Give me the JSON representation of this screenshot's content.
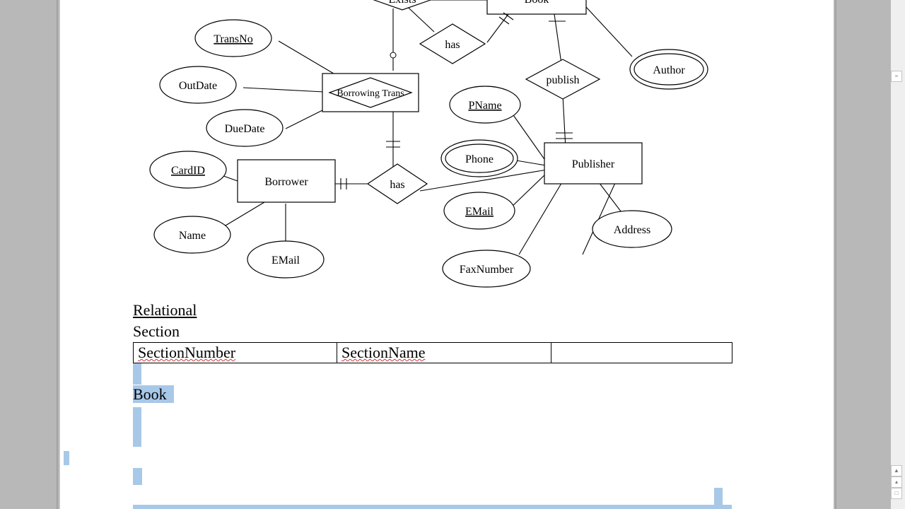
{
  "scroll": {
    "expand": "≡",
    "up": "▲",
    "top": "▴",
    "page": "□"
  },
  "diagram": {
    "entities": {
      "book": "Book",
      "borrowing": "Borrowing Trans",
      "borrower": "Borrower",
      "publisher": "Publisher"
    },
    "relationships": {
      "exists": "Exists",
      "has1": "has",
      "publish": "publish",
      "has2": "has"
    },
    "attributes": {
      "transno": "TransNo",
      "outdate": "OutDate",
      "duedate": "DueDate",
      "cardid": "CardID",
      "name": "Name",
      "email_borrower": "EMail",
      "author": "Author",
      "pname": "PName",
      "phone": "Phone",
      "email_pub": "EMail",
      "address": "Address",
      "faxnumber": "FaxNumber"
    }
  },
  "text": {
    "relational": "Relational",
    "section": "Section",
    "book": "Book"
  },
  "table": {
    "c1": "SectionNumber",
    "c2": "SectionName",
    "c3": ""
  }
}
